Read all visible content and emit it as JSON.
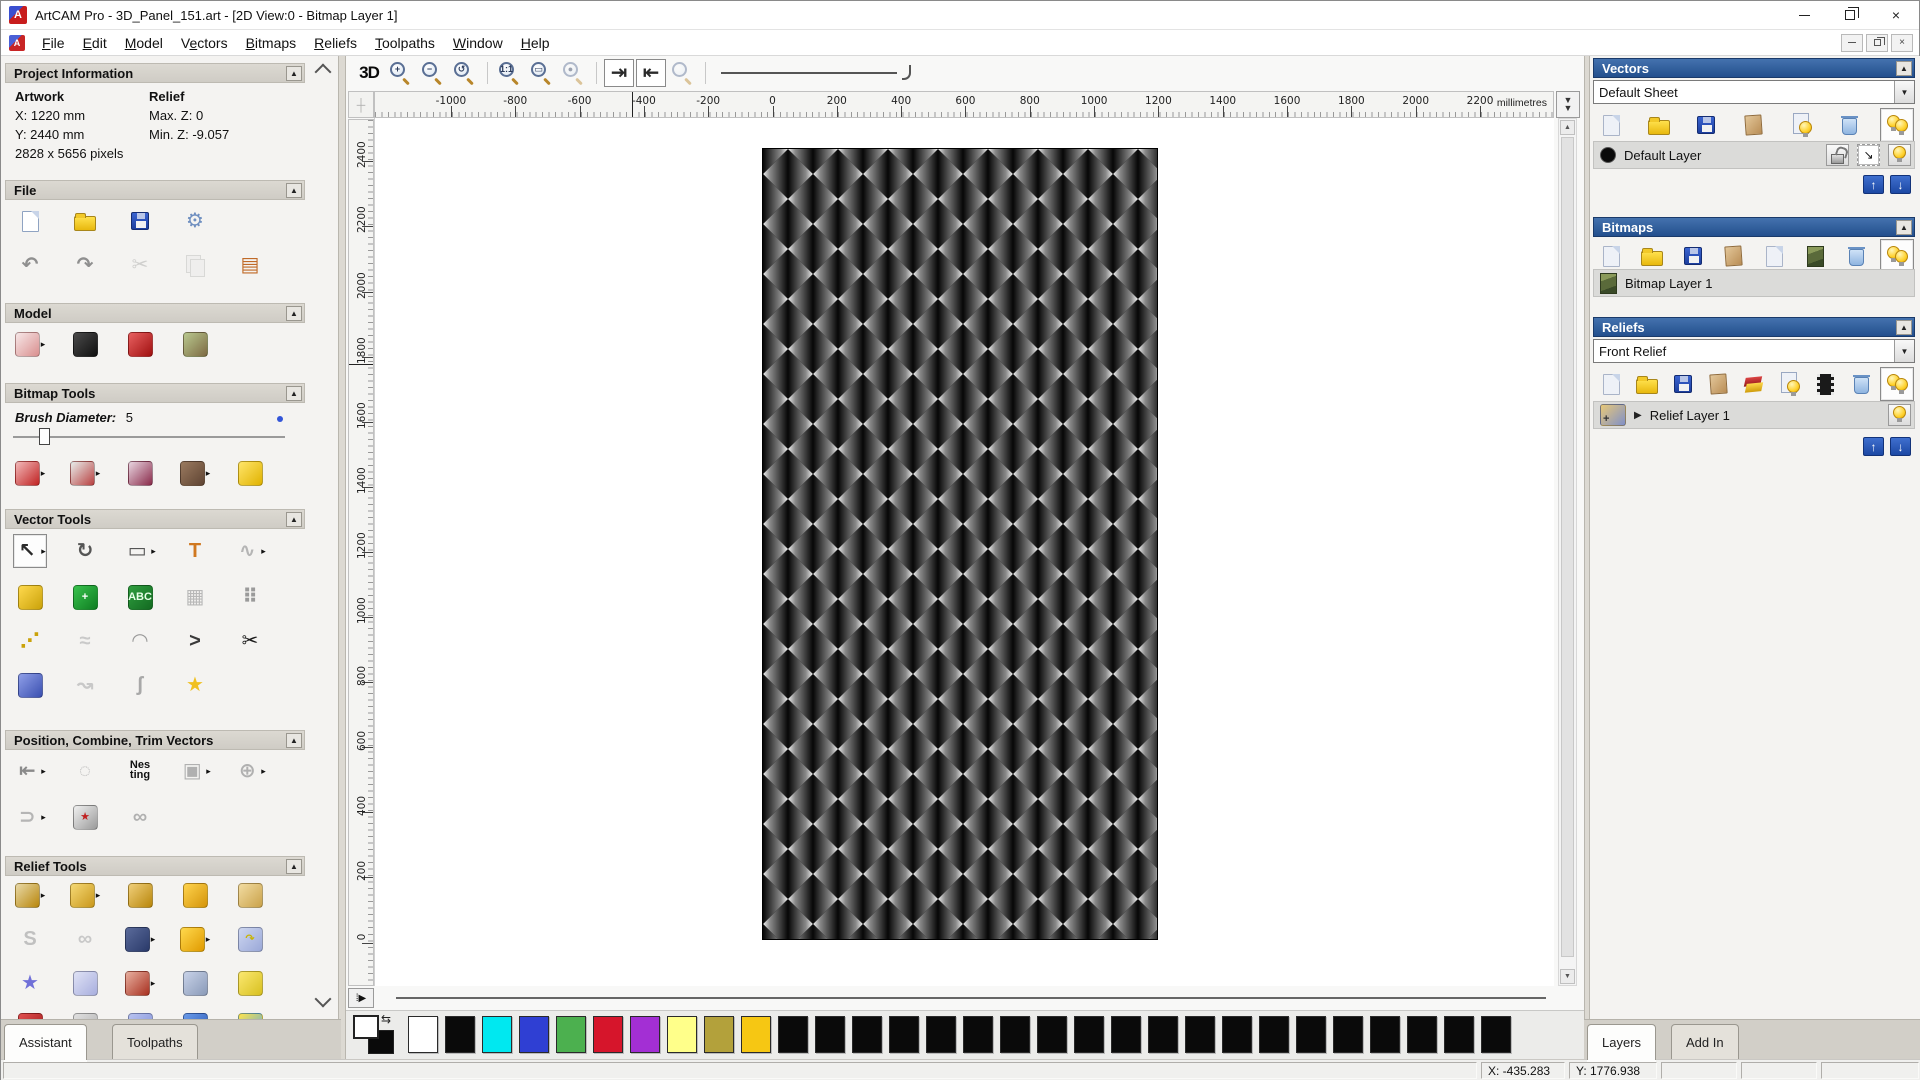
{
  "window": {
    "title": "ArtCAM Pro - 3D_Panel_151.art - [2D View:0 - Bitmap Layer 1]",
    "logo_letter": "A",
    "controls": [
      "minimize",
      "restore",
      "close"
    ]
  },
  "menu": {
    "items": [
      {
        "label": "File",
        "u": 0
      },
      {
        "label": "Edit",
        "u": 0
      },
      {
        "label": "Model",
        "u": 0
      },
      {
        "label": "Vectors",
        "u": 1
      },
      {
        "label": "Bitmaps",
        "u": 0
      },
      {
        "label": "Reliefs",
        "u": 0
      },
      {
        "label": "Toolpaths",
        "u": 0
      },
      {
        "label": "Window",
        "u": 0
      },
      {
        "label": "Help",
        "u": 0
      }
    ]
  },
  "left_panel": {
    "project_info": {
      "header": "Project Information",
      "artwork_label": "Artwork",
      "relief_label": "Relief",
      "x": "X: 1220 mm",
      "y": "Y: 2440 mm",
      "pixels": "2828 x 5656 pixels",
      "max_z": "Max. Z: 0",
      "min_z": "Min. Z: -9.057"
    },
    "file": {
      "header": "File",
      "rows": [
        [
          {
            "n": "new-model",
            "t": "page"
          },
          {
            "n": "open-model",
            "t": "folder"
          },
          {
            "n": "save-model",
            "t": "floppy"
          },
          {
            "n": "preferences",
            "t": "glyph",
            "g": "⚙",
            "c": "#6f8fc0"
          }
        ],
        [
          {
            "n": "undo",
            "t": "glyph",
            "g": "↶",
            "c": "#8f8f8f"
          },
          {
            "n": "redo",
            "t": "glyph",
            "g": "↷",
            "c": "#8f8f8f"
          },
          {
            "n": "cut",
            "t": "glyph",
            "g": "✂",
            "c": "#9a9a9a",
            "dis": 1
          },
          {
            "n": "copy",
            "t": "pages",
            "dis": 1
          },
          {
            "n": "paste",
            "t": "glyph",
            "g": "▤",
            "c": "#c06a28"
          }
        ]
      ]
    },
    "model": {
      "header": "Model",
      "rows": [
        [
          {
            "n": "set-model-size",
            "t": "art",
            "c": [
              "#f7e8e8",
              "#d98f8f"
            ],
            "fly": 1
          },
          {
            "n": "invert-model",
            "t": "art",
            "c": [
              "#4a4a4a",
              "#101010"
            ]
          },
          {
            "n": "render-preview",
            "t": "art",
            "c": [
              "#e86060",
              "#a01010"
            ]
          },
          {
            "n": "lightbox",
            "t": "art",
            "c": [
              "#b9c98f",
              "#7d6a43"
            ]
          }
        ]
      ]
    },
    "bitmap_tools": {
      "header": "Bitmap Tools",
      "brush_label": "Brush Diameter:",
      "brush_value": "5",
      "rows": [
        [
          {
            "n": "paint-tool",
            "t": "art",
            "c": [
              "#f2b9b9",
              "#c02222"
            ],
            "fly": 1
          },
          {
            "n": "flood-fill-tool",
            "t": "art",
            "c": [
              "#e8eeec",
              "#b84040"
            ],
            "fly": 1
          },
          {
            "n": "colour-picker",
            "t": "art",
            "c": [
              "#e8d5e0",
              "#8a2a4a"
            ]
          },
          {
            "n": "palette-tool",
            "t": "art",
            "c": [
              "#9a7a5f",
              "#5f4433"
            ],
            "fly": 1
          },
          {
            "n": "bitmap-flood-vector",
            "t": "art",
            "c": [
              "#ffe56a",
              "#e0b200"
            ]
          }
        ]
      ]
    },
    "vector_tools": {
      "header": "Vector Tools",
      "rows": [
        [
          {
            "n": "select-vectors",
            "t": "glyph",
            "g": "↖",
            "c": "#2a2a2a",
            "press": 1,
            "fly": 1
          },
          {
            "n": "transform-vectors",
            "t": "glyph",
            "g": "↻",
            "c": "#555555"
          },
          {
            "n": "create-rectangle",
            "t": "glyph",
            "g": "▭",
            "c": "#555555",
            "fly": 1
          },
          {
            "n": "create-text",
            "t": "glyph",
            "g": "T",
            "c": "#d07820"
          },
          {
            "n": "trim-tool",
            "t": "glyph",
            "g": "∿",
            "c": "#b5b5b5",
            "fly": 1
          }
        ],
        [
          {
            "n": "tape-measure",
            "t": "art",
            "c": [
              "#ffd94d",
              "#caa20a"
            ]
          },
          {
            "n": "block-copy",
            "t": "art",
            "c": [
              "#39c24d",
              "#0f7d22"
            ],
            "g": "+",
            "fg": "#ffffff"
          },
          {
            "n": "text-block",
            "t": "art",
            "c": [
              "#2f9e3f",
              "#136a21"
            ],
            "g": "ABC",
            "fg": "#e8ffe8"
          },
          {
            "n": "envelope-distort",
            "t": "glyph",
            "g": "▦",
            "c": "#b8b8b8"
          },
          {
            "n": "array-copy",
            "t": "glyph",
            "g": "⠿",
            "c": "#9a9a9a"
          }
        ],
        [
          {
            "n": "create-polyline",
            "t": "glyph",
            "g": "⋰",
            "c": "#caa20a"
          },
          {
            "n": "free-sketch",
            "t": "glyph",
            "g": "≈",
            "c": "#c9c9c9"
          },
          {
            "n": "bezier-edit",
            "t": "glyph",
            "g": "◠",
            "c": "#9a9a9a"
          },
          {
            "n": "arc-tool",
            "t": "glyph",
            "g": ">",
            "c": "#3a3a3a"
          },
          {
            "n": "vector-clip",
            "t": "glyph",
            "g": "✂",
            "c": "#1a1a1a"
          }
        ],
        [
          {
            "n": "offset-vector",
            "t": "art",
            "c": [
              "#8f9fe8",
              "#3a4fb0"
            ]
          },
          {
            "n": "fit-arcs",
            "t": "glyph",
            "g": "↝",
            "c": "#c8c8c8"
          },
          {
            "n": "node-edit",
            "t": "glyph",
            "g": "ʃ",
            "c": "#a8a8a8"
          },
          {
            "n": "fillet-tool",
            "t": "glyph",
            "g": "★",
            "c": "#f0c020"
          }
        ]
      ]
    },
    "position_combine": {
      "header": "Position, Combine, Trim Vectors",
      "rows": [
        [
          {
            "n": "align-vectors",
            "t": "glyph",
            "g": "⇤",
            "c": "#8a8a8a",
            "fly": 1
          },
          {
            "n": "text-on-curve",
            "t": "glyph",
            "g": "◌",
            "c": "#b5b5b5"
          },
          {
            "n": "nesting",
            "t": "nesting"
          },
          {
            "n": "group-vectors",
            "t": "glyph",
            "g": "▣",
            "c": "#b0b0b0",
            "fly": 1
          },
          {
            "n": "weld-vectors",
            "t": "glyph",
            "g": "⊕",
            "c": "#b0b0b0",
            "fly": 1
          }
        ],
        [
          {
            "n": "join-vectors",
            "t": "glyph",
            "g": "⊃",
            "c": "#b5b5b5",
            "fly": 1
          },
          {
            "n": "vector-texture",
            "t": "art",
            "c": [
              "#f0f0f0",
              "#9a9a9a"
            ],
            "g": "★",
            "fg": "#c02020"
          },
          {
            "n": "interlock-vectors",
            "t": "glyph",
            "g": "∞",
            "c": "#b0b0b0"
          }
        ]
      ]
    },
    "relief_tools": {
      "header": "Relief Tools",
      "rows": [
        [
          {
            "n": "relief-wizard",
            "t": "art",
            "c": [
              "#e8d9a8",
              "#b8860b"
            ],
            "fly": 1
          },
          {
            "n": "add-relief",
            "t": "art",
            "c": [
              "#f5d976",
              "#c9971c"
            ],
            "fly": 1
          },
          {
            "n": "shape-editor",
            "t": "art",
            "c": [
              "#f0cf7a",
              "#b8860b"
            ]
          },
          {
            "n": "smooth-relief",
            "t": "art",
            "c": [
              "#ffd34d",
              "#d4940a"
            ]
          },
          {
            "n": "sculpt-relief",
            "t": "art",
            "c": [
              "#f2dca2",
              "#caa24a"
            ]
          }
        ],
        [
          {
            "n": "swept-profile",
            "t": "glyph",
            "g": "S",
            "c": "#c0c0c0"
          },
          {
            "n": "weave-wizard",
            "t": "glyph",
            "g": "∞",
            "c": "#c8c8c8"
          },
          {
            "n": "texture-relief",
            "t": "art",
            "c": [
              "#5a6a9a",
              "#2a3a6a"
            ],
            "fly": 1
          },
          {
            "n": "two-rail-sweep",
            "t": "art",
            "c": [
              "#ffd94d",
              "#e09a00"
            ],
            "fly": 1
          },
          {
            "n": "flip-relief",
            "t": "art",
            "c": [
              "#cdd6f0",
              "#9aa8d8"
            ],
            "g": "↷",
            "fg": "#c8b400"
          }
        ],
        [
          {
            "n": "star-relief",
            "t": "glyph",
            "g": "★",
            "c": "#7070d8"
          },
          {
            "n": "pillow-relief",
            "t": "art",
            "c": [
              "#dfe2f5",
              "#a8aede"
            ]
          },
          {
            "n": "profile-relief",
            "t": "art",
            "c": [
              "#e8b0a0",
              "#a83020"
            ],
            "fly": 1
          },
          {
            "n": "emboss-relief",
            "t": "art",
            "c": [
              "#c8d2e8",
              "#8a9ab8"
            ]
          },
          {
            "n": "offset-relief",
            "t": "art",
            "c": [
              "#fbe870",
              "#d8c020"
            ]
          }
        ],
        [
          {
            "n": "wave-relief",
            "t": "art",
            "c": [
              "#e05050",
              "#a01818"
            ]
          },
          {
            "n": "basket-weave",
            "t": "art",
            "c": [
              "#e0e0e0",
              "#b0b0b0"
            ]
          },
          {
            "n": "dome-relief",
            "t": "art",
            "c": [
              "#b8c2f0",
              "#8090d8"
            ]
          },
          {
            "n": "texture-sphere",
            "t": "art",
            "c": [
              "#6a9ae8",
              "#2a5ab8"
            ]
          },
          {
            "n": "extrude-relief",
            "t": "art",
            "c": [
              "#ffe34d",
              "#58a8d8"
            ]
          }
        ]
      ]
    },
    "tabs": [
      {
        "label": "Assistant",
        "active": true
      },
      {
        "label": "Toolpaths",
        "active": false
      }
    ]
  },
  "view_toolbar": {
    "items": [
      {
        "n": "view-3d",
        "t": "3d",
        "g": "3D"
      },
      {
        "n": "zoom-in",
        "t": "mag",
        "g": "+"
      },
      {
        "n": "zoom-out",
        "t": "mag",
        "g": "−"
      },
      {
        "n": "zoom-previous",
        "t": "mag",
        "g": "↺"
      },
      {
        "t": "sep"
      },
      {
        "n": "zoom-1to1",
        "t": "mag",
        "g": "1:1"
      },
      {
        "n": "zoom-rect",
        "t": "mag",
        "g": "▭"
      },
      {
        "n": "zoom-object",
        "t": "mag",
        "g": "●",
        "dis": 1
      },
      {
        "t": "sep"
      },
      {
        "n": "toggle-bitmap-visibility",
        "t": "glyph",
        "g": "⇥",
        "c": "#2a2a2a",
        "press": 1
      },
      {
        "n": "toggle-vector-visibility",
        "t": "glyph",
        "g": "⇤",
        "c": "#2a2a2a",
        "press": 1
      },
      {
        "n": "preview-relief-layer",
        "t": "mag",
        "g": "",
        "dis": 1
      },
      {
        "t": "sep"
      },
      {
        "t": "slider"
      }
    ]
  },
  "rulers": {
    "unit": "millimetres",
    "top_labels": [
      -1000,
      -800,
      -600,
      -400,
      -200,
      0,
      200,
      400,
      600,
      800,
      1000,
      1200,
      1400,
      1600,
      1800,
      2000,
      2200
    ],
    "left_labels": [
      2400,
      2200,
      2000,
      1800,
      1600,
      1400,
      1200,
      1000,
      800,
      600,
      400,
      200,
      0
    ]
  },
  "palette": {
    "front": "#ffffff",
    "back": "#0a0a0a",
    "swatches": [
      "#ffffff",
      "#0a0a0a",
      "#00e8f0",
      "#2f3fd3",
      "#4cb04f",
      "#d6152b",
      "#a32fd4",
      "#ffff8a",
      "#b3a13b",
      "#f6c713",
      "#0a0a0a",
      "#0a0a0a",
      "#0a0a0a",
      "#0a0a0a",
      "#0a0a0a",
      "#0a0a0a",
      "#0a0a0a",
      "#0a0a0a",
      "#0a0a0a",
      "#0a0a0a",
      "#0a0a0a",
      "#0a0a0a",
      "#0a0a0a",
      "#0a0a0a",
      "#0a0a0a",
      "#0a0a0a",
      "#0a0a0a",
      "#0a0a0a",
      "#0a0a0a",
      "#0a0a0a"
    ]
  },
  "right_panel": {
    "vectors": {
      "header": "Vectors",
      "sheet": "Default Sheet",
      "icons": [
        {
          "n": "new-vector-layer",
          "t": "pagedim"
        },
        {
          "n": "open-vector-layer",
          "t": "folder"
        },
        {
          "n": "save-vector-layer",
          "t": "floppy"
        },
        {
          "n": "merge-vector-layers",
          "t": "tan"
        },
        {
          "n": "vector-layer-visibility",
          "t": "pagebulb"
        },
        {
          "n": "delete-vector-layer",
          "t": "trash"
        },
        {
          "n": "toggle-all-vector-layers",
          "t": "bulb2",
          "press": 1
        }
      ],
      "layer_name": "Default Layer"
    },
    "bitmaps": {
      "header": "Bitmaps",
      "icons": [
        {
          "n": "new-bitmap-layer",
          "t": "pagedim"
        },
        {
          "n": "open-bitmap-layer",
          "t": "folder"
        },
        {
          "n": "save-bitmap-layer",
          "t": "floppy"
        },
        {
          "n": "merge-bitmap-layers",
          "t": "tan"
        },
        {
          "n": "blank-bitmap-layer",
          "t": "pagedim"
        },
        {
          "n": "copy-bitmap-layer",
          "t": "mona"
        },
        {
          "n": "delete-bitmap-layer",
          "t": "trash"
        },
        {
          "n": "toggle-all-bitmap-layers",
          "t": "bulb2",
          "press": 1
        }
      ],
      "layer_name": "Bitmap Layer 1"
    },
    "reliefs": {
      "header": "Reliefs",
      "relief": "Front Relief",
      "icons": [
        {
          "n": "new-relief-layer",
          "t": "pagedim"
        },
        {
          "n": "open-relief-layer",
          "t": "folder"
        },
        {
          "n": "save-relief-layer",
          "t": "floppy"
        },
        {
          "n": "merge-relief-layers",
          "t": "tan"
        },
        {
          "n": "transfer-relief-layer",
          "t": "stack"
        },
        {
          "n": "relief-layer-visibility",
          "t": "pagebulb"
        },
        {
          "n": "greyscale-relief",
          "t": "film"
        },
        {
          "n": "delete-relief-layer",
          "t": "trash"
        },
        {
          "n": "toggle-all-relief-layers",
          "t": "bulb2",
          "press": 1
        }
      ],
      "layer_name": "Relief Layer 1"
    },
    "tabs": [
      {
        "label": "Layers",
        "active": true
      },
      {
        "label": "Add In",
        "active": false
      }
    ]
  },
  "status_bar": {
    "x": "X: -435.283",
    "y": "Y: 1776.938"
  }
}
